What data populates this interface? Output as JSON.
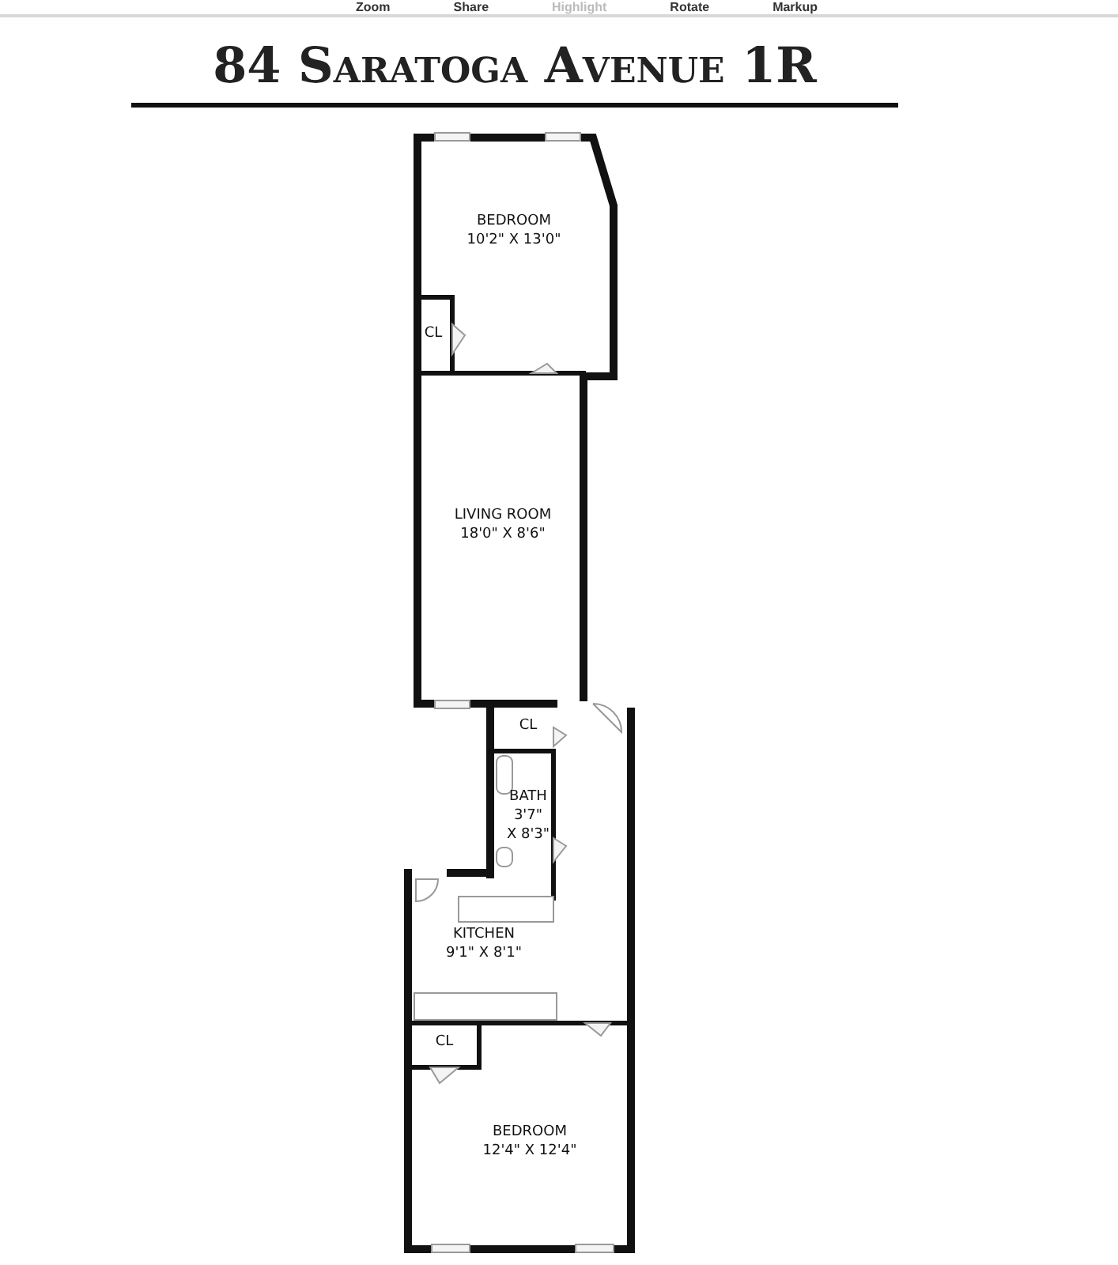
{
  "toolbar": [
    {
      "label": "Zoom",
      "disabled": false
    },
    {
      "label": "Share",
      "disabled": false
    },
    {
      "label": "Highlight",
      "disabled": true
    },
    {
      "label": "Rotate",
      "disabled": false
    },
    {
      "label": "Markup",
      "disabled": false
    }
  ],
  "title": "84 Saratoga Avenue 1R",
  "rooms": [
    {
      "name": "BEDROOM",
      "lines": [
        "10'2\" X 13'0\""
      ]
    },
    {
      "name": "CL"
    },
    {
      "name": "LIVING ROOM",
      "lines": [
        "18'0\" X 8'6\""
      ]
    },
    {
      "name": "CL"
    },
    {
      "name": "BATH",
      "lines": [
        "3'7\"",
        "X 8'3\""
      ]
    },
    {
      "name": "KITCHEN",
      "lines": [
        "9'1\" X 8'1\""
      ]
    },
    {
      "name": "CL"
    },
    {
      "name": "BEDROOM",
      "lines": [
        "12'4\" X 12'4\""
      ]
    }
  ]
}
